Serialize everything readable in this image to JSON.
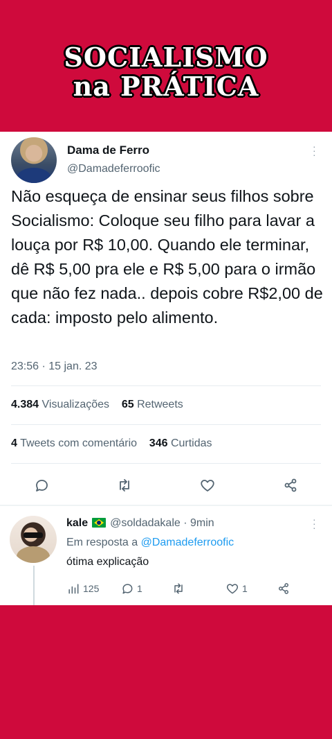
{
  "banner": {
    "line1": "SOCIALISMO",
    "line2": "na PRÁTICA"
  },
  "tweet": {
    "author_name": "Dama de Ferro",
    "author_handle": "@Damadeferroofic",
    "text": "Não esqueça de ensinar seus filhos sobre Socialismo: Coloque seu filho para lavar a louça por R$ 10,00. Quando ele terminar, dê R$ 5,00 pra ele e R$ 5,00 para o irmão que não fez nada.. depois cobre R$2,00 de cada: imposto pelo alimento.",
    "timestamp": "23:56 · 15 jan. 23",
    "views_count": "4.384",
    "views_label": "Visualizações",
    "retweets_count": "65",
    "retweets_label": "Retweets",
    "quotes_count": "4",
    "quotes_label": "Tweets com comentário",
    "likes_count": "346",
    "likes_label": "Curtidas",
    "icons": [
      "reply-icon",
      "retweet-icon",
      "like-icon",
      "share-icon",
      "more-icon"
    ]
  },
  "reply": {
    "author_name": "kale",
    "flag": "brazil-flag",
    "author_handle": "@soldadakale",
    "time": "· 9min",
    "in_reply_prefix": "Em resposta a",
    "in_reply_handle": "@Damadeferroofic",
    "text": "ótima explicação",
    "views": "125",
    "replies": "1",
    "likes": "1"
  },
  "colors": {
    "brand_red": "#cf0a3c",
    "link_blue": "#1d9bf0",
    "text_primary": "#0f1419",
    "text_secondary": "#536471"
  }
}
